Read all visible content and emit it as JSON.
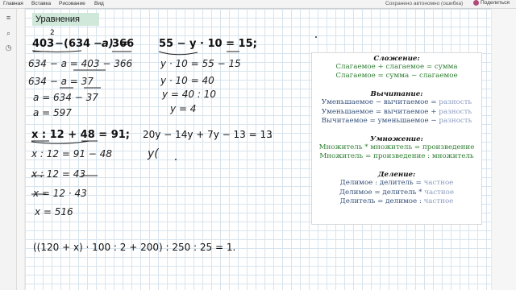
{
  "menu": {
    "items": [
      "Главная",
      "Вставка",
      "Рисование",
      "Вид"
    ],
    "status": "Сохранено автономно (ошибка)",
    "share": "Поделиться"
  },
  "page": {
    "title": "Уравнения"
  },
  "equations": {
    "eq1": {
      "a": "403",
      "sup": "2",
      "b": "(634",
      "c": "a)",
      "eq": "=",
      "d": "366"
    },
    "eq1_steps": [
      "634 − a = 403 − 366",
      "634 − a = 37",
      "a = 634 − 37",
      "a = 597"
    ],
    "eq2": "55 − y · 10 = 15;",
    "eq2_steps": [
      "y · 10 = 55 − 15",
      "y · 10 = 40",
      "y = 40 : 10",
      "y = 4"
    ],
    "eq3": "x : 12 + 48 = 91;",
    "eq3_steps": [
      "x : 12 = 91 − 48",
      "x : 12 = 43",
      "x = 12 · 43",
      "x = 516"
    ],
    "eq4": "20y − 14y + 7y − 13 = 13",
    "eq4_steps": [
      "y("
    ],
    "eq5": "((120 + x) · 100 : 2 + 200) : 250 : 25 = 1."
  },
  "reference": {
    "addition": {
      "header": "Сложение:",
      "lines": [
        "Слагаемое + слагаемое = сумма",
        "Слагаемое = сумма − слагаемое"
      ]
    },
    "subtraction": {
      "header": "Вычитание:",
      "lines": [
        [
          "Уменьшаемое − вычитаемое = ",
          "разность"
        ],
        [
          "Уменьшаемое = вычитаемое + ",
          "разность"
        ],
        [
          "Вычитаемое =  уменьшаемое − ",
          "разность"
        ]
      ]
    },
    "multiplication": {
      "header": "Умножение:",
      "lines": [
        "Множитель *  множитель = произведение",
        "Множитель = произведение : множитель"
      ]
    },
    "division": {
      "header": "Деление:",
      "lines": [
        [
          "Делимое : делитель = ",
          "частное"
        ],
        [
          "Делимое = делитель * ",
          "частное"
        ],
        [
          "Делитель = делимое : ",
          "частное"
        ]
      ]
    }
  },
  "colors": {
    "title_bg": "#cfe8da",
    "grid": "#d7e4ee",
    "green": "#2e7d32",
    "blue": "#35507a",
    "light_label": "#8a9bbf"
  },
  "icons": [
    "notebooks-icon",
    "search-icon",
    "recent-icon",
    "share-icon"
  ]
}
